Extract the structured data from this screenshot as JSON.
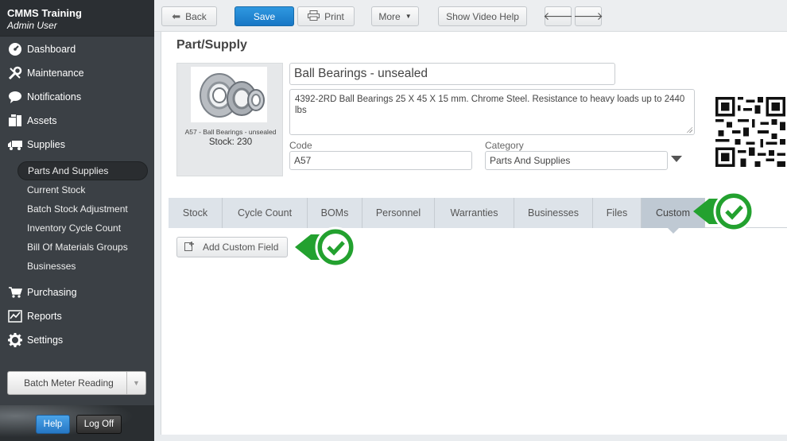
{
  "sidebar": {
    "app_title": "CMMS Training",
    "user": "Admin User",
    "nav": [
      {
        "label": "Dashboard",
        "icon": "dashboard-gauge-icon"
      },
      {
        "label": "Maintenance",
        "icon": "wrench-icon"
      },
      {
        "label": "Notifications",
        "icon": "speech-bubble-icon"
      },
      {
        "label": "Assets",
        "icon": "boxes-icon"
      },
      {
        "label": "Supplies",
        "icon": "truck-icon"
      }
    ],
    "supplies_sub": [
      {
        "label": "Parts And Supplies",
        "active": true
      },
      {
        "label": "Current Stock"
      },
      {
        "label": "Batch Stock Adjustment"
      },
      {
        "label": "Inventory Cycle Count"
      },
      {
        "label": "Bill Of Materials Groups"
      },
      {
        "label": "Businesses"
      }
    ],
    "nav2": [
      {
        "label": "Purchasing",
        "icon": "cart-icon"
      },
      {
        "label": "Reports",
        "icon": "chart-icon"
      },
      {
        "label": "Settings",
        "icon": "gear-icon"
      }
    ],
    "batch_select": "Batch Meter Reading",
    "help": "Help",
    "logoff": "Log Off"
  },
  "toolbar": {
    "back": "Back",
    "save": "Save",
    "print": "Print",
    "more": "More",
    "video_help": "Show Video Help"
  },
  "page": {
    "title": "Part/Supply",
    "image_caption": "A57 - Ball Bearings - unsealed",
    "stock_label": "Stock: 230",
    "name": "Ball Bearings - unsealed",
    "description": "4392-2RD Ball Bearings 25 X 45 X 15 mm. Chrome Steel. Resistance to heavy loads up to 2440 lbs",
    "code_label": "Code",
    "code": "A57",
    "category_label": "Category",
    "category": "Parts And Supplies"
  },
  "tabs": [
    {
      "label": "Stock"
    },
    {
      "label": "Cycle Count"
    },
    {
      "label": "BOMs"
    },
    {
      "label": "Personnel"
    },
    {
      "label": "Warranties"
    },
    {
      "label": "Businesses"
    },
    {
      "label": "Files"
    },
    {
      "label": "Custom",
      "active": true
    }
  ],
  "custom": {
    "add_field": "Add Custom Field"
  },
  "colors": {
    "primary": "#1f86d3",
    "callout_green": "#23a12f",
    "sidebar_bg": "#3b4045"
  }
}
